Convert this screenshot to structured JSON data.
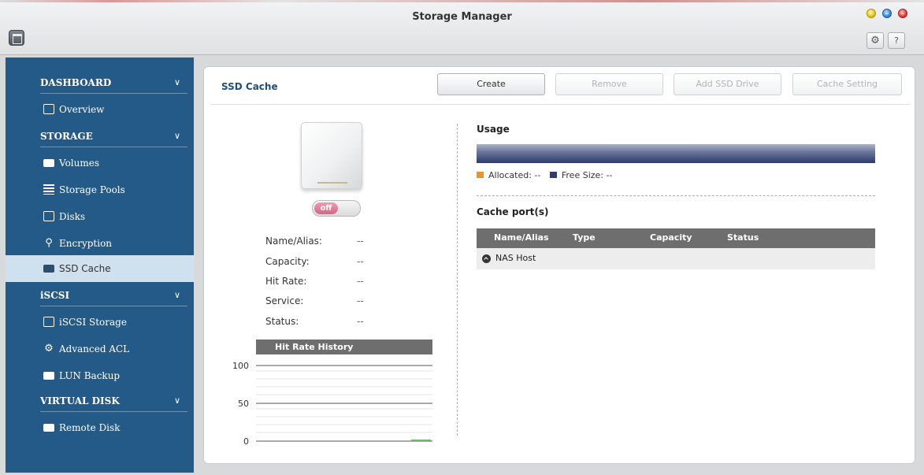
{
  "window": {
    "title": "Storage Manager"
  },
  "sidebar": {
    "sections": [
      {
        "label": "DASHBOARD",
        "items": [
          {
            "label": "Overview",
            "icon": "overview-icon"
          }
        ]
      },
      {
        "label": "STORAGE",
        "items": [
          {
            "label": "Volumes",
            "icon": "volume-icon"
          },
          {
            "label": "Storage Pools",
            "icon": "storage-pool-icon"
          },
          {
            "label": "Disks",
            "icon": "disk-icon"
          },
          {
            "label": "Encryption",
            "icon": "key-icon"
          },
          {
            "label": "SSD Cache",
            "icon": "ssd-icon",
            "active": true
          }
        ]
      },
      {
        "label": "iSCSI",
        "items": [
          {
            "label": "iSCSI Storage",
            "icon": "iscsi-storage-icon"
          },
          {
            "label": "Advanced ACL",
            "icon": "gear-icon"
          },
          {
            "label": "LUN Backup",
            "icon": "backup-icon"
          }
        ]
      },
      {
        "label": "VIRTUAL DISK",
        "items": [
          {
            "label": "Remote Disk",
            "icon": "remote-disk-icon"
          }
        ]
      }
    ]
  },
  "main": {
    "title": "SSD Cache",
    "buttons": {
      "create": "Create",
      "remove": "Remove",
      "add_ssd": "Add SSD Drive",
      "cache_setting": "Cache Setting"
    },
    "toggle": {
      "label": "off",
      "state": "off"
    },
    "info": {
      "name_label": "Name/Alias:",
      "name_value": "--",
      "capacity_label": "Capacity:",
      "capacity_value": "--",
      "hitrate_label": "Hit Rate:",
      "hitrate_value": "--",
      "service_label": "Service:",
      "service_value": "--",
      "status_label": "Status:",
      "status_value": "--"
    },
    "hit_rate_history": {
      "title": "Hit Rate History",
      "ticks": [
        "100",
        "50",
        "0"
      ]
    },
    "usage": {
      "title": "Usage",
      "allocated": "Allocated: --",
      "free_size": "Free Size: --",
      "allocated_color": "#e8962b",
      "free_color": "#2f3c6d"
    },
    "cache_ports": {
      "title": "Cache port(s)",
      "columns": [
        "Name/Alias",
        "Type",
        "Capacity",
        "Status"
      ],
      "rows": [
        {
          "name": "NAS Host"
        }
      ]
    }
  }
}
